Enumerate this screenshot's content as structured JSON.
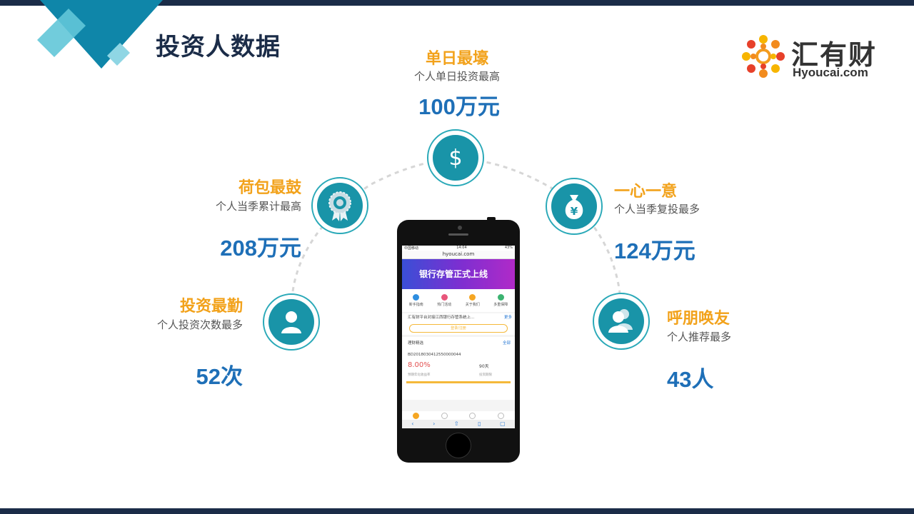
{
  "header": {
    "title": "投资人数据"
  },
  "logo": {
    "name_cn": "汇有财",
    "name_en": "Hyoucai.com"
  },
  "stats": {
    "top": {
      "title": "单日最壕",
      "subtitle": "个人单日投资最高",
      "value": "100万元",
      "icon": "dollar-icon"
    },
    "left_upper": {
      "title": "荷包最鼓",
      "subtitle": "个人当季累计最高",
      "value": "208万元",
      "icon": "award-badge-icon"
    },
    "left_lower": {
      "title": "投资最勤",
      "subtitle": "个人投资次数最多",
      "value": "52次",
      "icon": "person-icon"
    },
    "right_upper": {
      "title": "一心一意",
      "subtitle": "个人当季复投最多",
      "value": "124万元",
      "icon": "yen-bag-icon"
    },
    "right_lower": {
      "title": "呼朋唤友",
      "subtitle": "个人推荐最多",
      "value": "43人",
      "icon": "group-icon"
    }
  },
  "phone": {
    "status_left": "中国移动",
    "status_time": "14:04",
    "status_right": "43%",
    "url": "hyoucai.com",
    "banner_text": "银行存管正式上线",
    "quick_links": [
      "新手指南",
      "热门活动",
      "关于我们",
      "多重保障"
    ],
    "notice": "汇有财平台对接江西银行存管系统上...",
    "notice_more": "更多",
    "login_label": "登录/注册",
    "product_header": "理财精选",
    "product_more": "全部",
    "product_code": "BD2018030412550000044",
    "product_rate": "8.00%",
    "product_rate_label": "预期年化收益率",
    "product_days": "90天",
    "product_days_label": "投资期限"
  },
  "colors": {
    "accent_orange": "#f2a21b",
    "accent_blue": "#1e6fb7",
    "teal": "#1994a8",
    "navy": "#1b2c48"
  }
}
